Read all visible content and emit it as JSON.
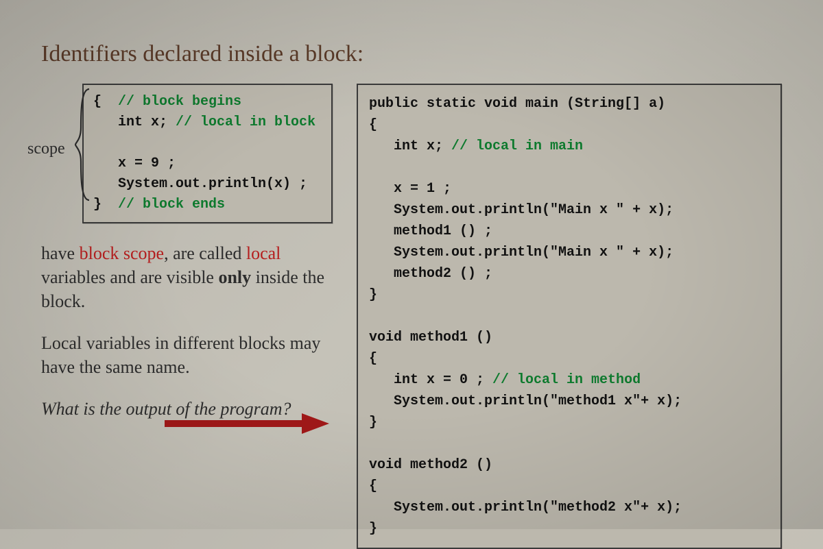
{
  "title": "Identifiers declared inside a block:",
  "scope_label": "scope",
  "left_code": {
    "l1a": "{  ",
    "l1b": "// block begins",
    "l2a": "   int x; ",
    "l2b": "// local in block",
    "l3": "",
    "l4": "   x = 9 ;",
    "l5": "   System.out.println(x) ;",
    "l6a": "}  ",
    "l6b": "// block ends"
  },
  "para1": {
    "p1": "have ",
    "p2": "block scope",
    "p3": ", are called ",
    "p4": "local",
    "p5": " variables and are visible ",
    "p6": "only",
    "p7": " inside the block."
  },
  "para2": "Local variables in different blocks may have the same name.",
  "para3": "What is the output of the program?",
  "right_code": {
    "l1": "public static void main (String[] a)",
    "l2": "{",
    "l3a": "   int x; ",
    "l3b": "// local in main",
    "l4": "",
    "l5": "   x = 1 ;",
    "l6": "   System.out.println(\"Main x \" + x);",
    "l7": "   method1 () ;",
    "l8": "   System.out.println(\"Main x \" + x);",
    "l9": "   method2 () ;",
    "l10": "}",
    "l11": "",
    "l12": "void method1 ()",
    "l13": "{",
    "l14a": "   int x = 0 ; ",
    "l14b": "// local in method",
    "l15": "   System.out.println(\"method1 x\"+ x);",
    "l16": "}",
    "l17": "",
    "l18": "void method2 ()",
    "l19": "{",
    "l20": "   System.out.println(\"method2 x\"+ x);",
    "l21": "}"
  }
}
